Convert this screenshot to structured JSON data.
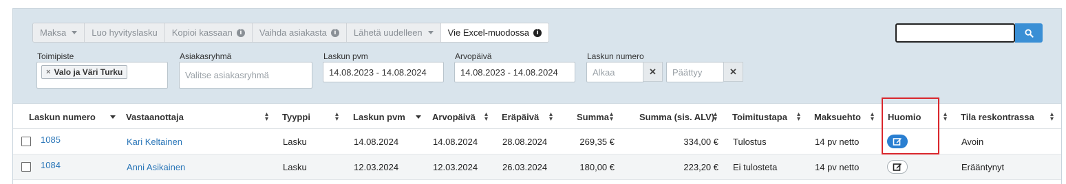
{
  "toolbar": {
    "buttons": [
      {
        "label": "Maksa",
        "icon": "caret-down-icon"
      },
      {
        "label": "Luo hyvityslasku"
      },
      {
        "label": "Kopioi kassaan",
        "icon": "info-icon"
      },
      {
        "label": "Vaihda asiakasta",
        "icon": "info-icon"
      },
      {
        "label": "Lähetä uudelleen",
        "icon": "caret-down-icon"
      },
      {
        "label": "Vie Excel-muodossa",
        "icon": "info-icon"
      }
    ]
  },
  "search": {
    "value": "",
    "icon": "search-icon"
  },
  "filters": {
    "toimipiste": {
      "label": "Toimipiste",
      "tag": "Valo ja Väri Turku"
    },
    "asiakasryhma": {
      "label": "Asiakasryhmä",
      "placeholder": "Valitse asiakasryhmä"
    },
    "laskun_pvm": {
      "label": "Laskun pvm",
      "value": "14.08.2023 - 14.08.2024"
    },
    "arvopaiva": {
      "label": "Arvopäivä",
      "value": "14.08.2023 - 14.08.2024"
    },
    "laskun_numero": {
      "label": "Laskun numero",
      "from_placeholder": "Alkaa",
      "to_placeholder": "Päättyy"
    }
  },
  "table": {
    "columns": [
      "Laskun numero",
      "Vastaanottaja",
      "Tyyppi",
      "Laskun pvm",
      "Arvopäivä",
      "Eräpäivä",
      "Summa",
      "Summa (sis. ALV)",
      "Toimitustapa",
      "Maksuehto",
      "Huomio",
      "Tila reskontrassa"
    ],
    "rows": [
      {
        "numero": "1085",
        "vastaanottaja": "Kari Keltainen",
        "tyyppi": "Lasku",
        "laskun_pvm": "14.08.2024",
        "arvopaiva": "14.08.2024",
        "erapaiva": "28.08.2024",
        "summa": "269,35 €",
        "summa_alv": "334,00 €",
        "toimitustapa": "Tulostus",
        "maksuehto": "14 pv netto",
        "huomio_icon": "edit-note-icon",
        "tila": "Avoin"
      },
      {
        "numero": "1084",
        "vastaanottaja": "Anni Asikainen",
        "tyyppi": "Lasku",
        "laskun_pvm": "12.03.2024",
        "arvopaiva": "12.03.2024",
        "erapaiva": "26.03.2024",
        "summa": "180,00 €",
        "summa_alv": "223,20 €",
        "toimitustapa": "Ei tulosteta",
        "maksuehto": "14 pv netto",
        "huomio_icon": "edit-note-icon",
        "tila": "Erääntynyt"
      }
    ]
  },
  "colors": {
    "accent": "#3a8fd5",
    "highlight": "#d9262c",
    "link": "#2a76b8",
    "filter_bg": "#d9e4ec"
  }
}
